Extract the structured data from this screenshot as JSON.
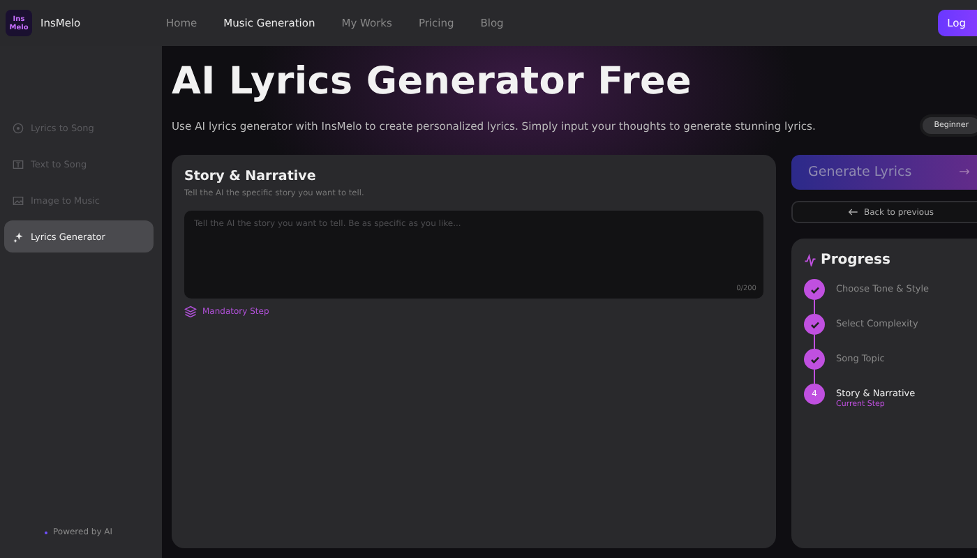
{
  "brand": {
    "logo": "Ins Melo",
    "name": "InsMelo"
  },
  "nav": [
    {
      "label": "Home",
      "selected": false
    },
    {
      "label": "Music Generation",
      "selected": true
    },
    {
      "label": "My Works",
      "selected": false
    },
    {
      "label": "Pricing",
      "selected": false
    },
    {
      "label": "Blog",
      "selected": false
    }
  ],
  "login_button": "Log",
  "sidebar": {
    "items": [
      {
        "label": "Lyrics to Song",
        "kind": "disc",
        "selected": false
      },
      {
        "label": "Text to Song",
        "kind": "text",
        "selected": false
      },
      {
        "label": "Image to Music",
        "kind": "image",
        "selected": false
      },
      {
        "label": "Lyrics Generator",
        "kind": "sparkle",
        "selected": true
      }
    ],
    "footer": "Powered by AI"
  },
  "title": "AI Lyrics Generator Free",
  "subtitle": "Use AI lyrics generator with InsMelo to create personalized lyrics. Simply input your thoughts to generate stunning lyrics.",
  "level_badge": "Beginner",
  "story": {
    "heading": "Story & Narrative",
    "hint": "Tell the AI the specific story you want to tell.",
    "placeholder": "Tell the AI the story you want to tell. Be as specific as you like...",
    "counter": "0/200",
    "note": "Mandatory Step"
  },
  "generate_button": {
    "label": "Generate Lyrics",
    "arrow": "→"
  },
  "back_button": "Back to previous",
  "progress": {
    "heading": "Progress",
    "steps": [
      {
        "label": "Choose Tone & Style",
        "completed": true
      },
      {
        "label": "Select Complexity",
        "completed": true
      },
      {
        "label": "Song Topic",
        "completed": true
      },
      {
        "label": "Story & Narrative",
        "completed": false,
        "number": "4",
        "note": "Current Step"
      }
    ]
  }
}
